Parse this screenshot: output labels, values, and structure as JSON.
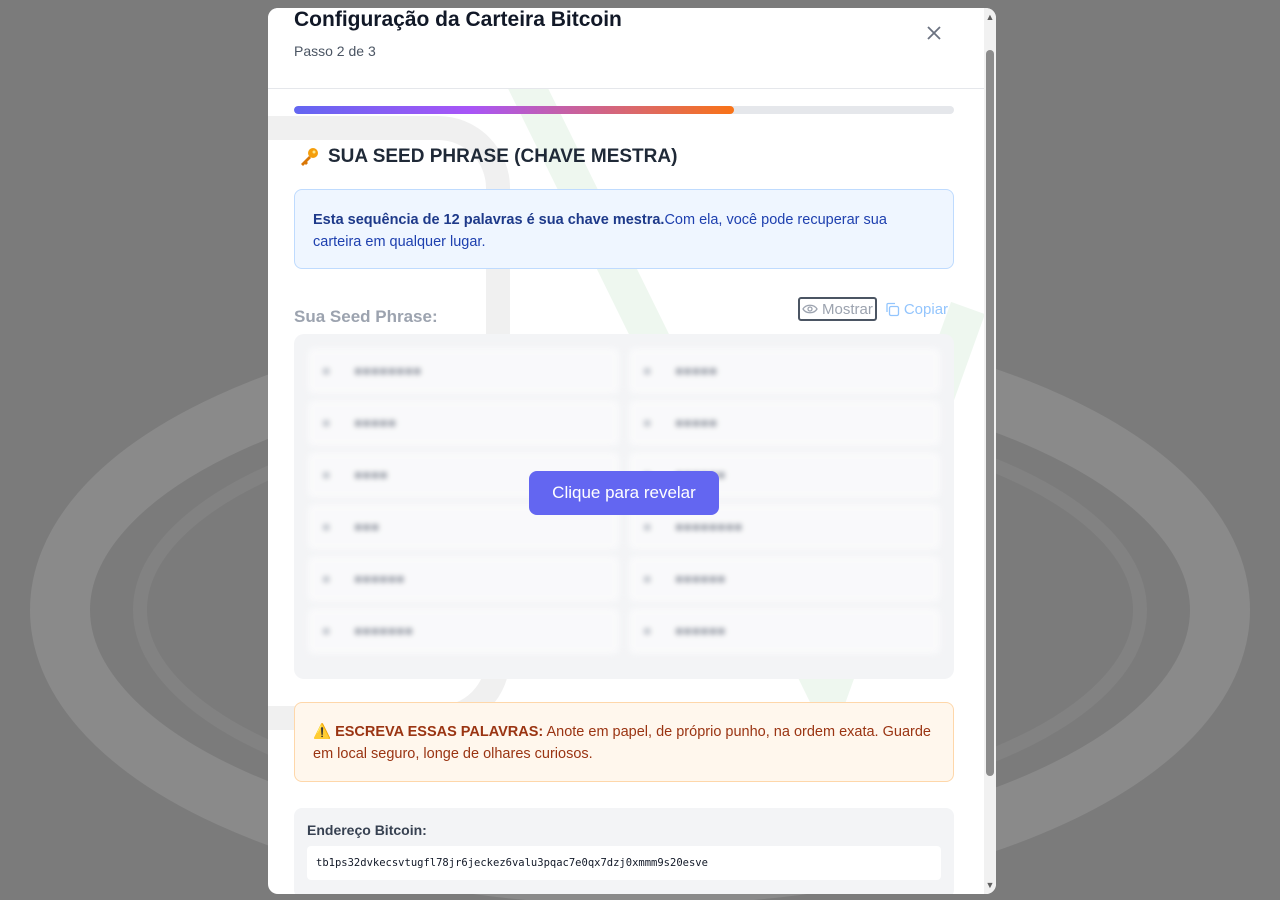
{
  "header": {
    "title": "Configuração da Carteira Bitcoin",
    "subtitle": "Passo 2 de 3",
    "close_icon": "close-icon"
  },
  "progress": {
    "fraction": 0.667
  },
  "seed_section": {
    "icon": "key-icon",
    "title": "SUA SEED PHRASE (CHAVE MESTRA)",
    "info_bold": "Esta sequência de 12 palavras é sua chave mestra.",
    "info_text": "Com ela, você pode recuperar sua carteira em qualquer lugar.",
    "label": "Sua Seed Phrase:",
    "show_label": "Mostrar",
    "copy_label": "Copiar",
    "reveal_label": "Clique para revelar"
  },
  "warning": {
    "bold": "ESCREVA ESSAS PALAVRAS:",
    "text": " Anote em papel, de próprio punho, na ordem exata. Guarde em local seguro, longe de olhares curiosos."
  },
  "address": {
    "label": "Endereço Bitcoin:",
    "value": "tb1ps32dvkecsvtugfl78jr6jeckez6valu3pqac7e0qx7dzj0xmmm9s20esve"
  },
  "colors": {
    "accent": "#6366f1",
    "info_bg": "#eff6ff",
    "warning_bg": "#fff7ed",
    "backdrop": "#7b7b7b"
  }
}
